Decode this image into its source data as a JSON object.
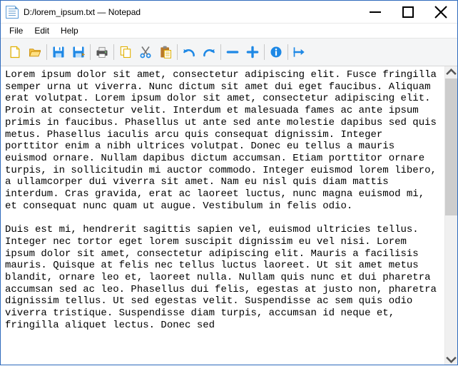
{
  "window": {
    "title": "D:/lorem_ipsum.txt — Notepad"
  },
  "menu": {
    "file": "File",
    "edit": "Edit",
    "help": "Help"
  },
  "toolbar_icons": {
    "new": "new-file-icon",
    "open": "open-file-icon",
    "save": "save-icon",
    "saveas": "save-as-icon",
    "print": "print-icon",
    "copy": "copy-icon",
    "cut": "cut-icon",
    "paste": "paste-icon",
    "undo": "undo-icon",
    "redo": "redo-icon",
    "zoomout": "zoom-out-icon",
    "zoomin": "zoom-in-icon",
    "info": "info-icon",
    "exit": "exit-icon"
  },
  "editor": {
    "text": "Lorem ipsum dolor sit amet, consectetur adipiscing elit. Fusce fringilla semper urna ut viverra. Nunc dictum sit amet dui eget faucibus. Aliquam erat volutpat. Lorem ipsum dolor sit amet, consectetur adipiscing elit. Proin at consectetur velit. Interdum et malesuada fames ac ante ipsum primis in faucibus. Phasellus ut ante sed ante molestie dapibus sed quis metus. Phasellus iaculis arcu quis consequat dignissim. Integer porttitor enim a nibh ultrices volutpat. Donec eu tellus a mauris euismod ornare. Nullam dapibus dictum accumsan. Etiam porttitor ornare turpis, in sollicitudin mi auctor commodo. Integer euismod lorem libero, a ullamcorper dui viverra sit amet. Nam eu nisl quis diam mattis interdum. Cras gravida, erat ac laoreet luctus, nunc magna euismod mi, et consequat nunc quam ut augue. Vestibulum in felis odio.\n\nDuis est mi, hendrerit sagittis sapien vel, euismod ultricies tellus. Integer nec tortor eget lorem suscipit dignissim eu vel nisi. Lorem ipsum dolor sit amet, consectetur adipiscing elit. Mauris a facilisis mauris. Quisque at felis nec tellus luctus laoreet. Ut sit amet metus blandit, ornare leo et, laoreet nulla. Nullam quis nunc et dui pharetra accumsan sed ac leo. Phasellus dui felis, egestas at justo non, pharetra dignissim tellus. Ut sed egestas velit. Suspendisse ac sem quis odio viverra tristique. Suspendisse diam turpis, accumsan id neque et, fringilla aliquet lectus. Donec sed"
  }
}
